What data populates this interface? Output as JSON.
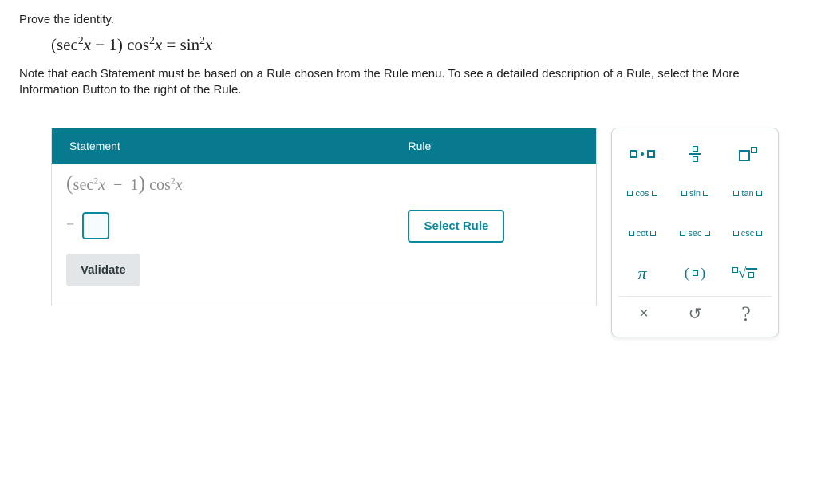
{
  "prompt": {
    "title": "Prove the identity.",
    "identity_html": "(sec²x − 1) cos²x = sin²x",
    "note": "Note that each Statement must be based on a Rule chosen from the Rule menu. To see a detailed description of a Rule, select the More Information Button to the right of the Rule."
  },
  "proof": {
    "header_statement": "Statement",
    "header_rule": "Rule",
    "starting_expr": "(sec²x − 1) cos²x",
    "equals": "=",
    "select_rule_label": "Select Rule",
    "validate_label": "Validate"
  },
  "palette": {
    "row1": {
      "mult": "·"
    },
    "row2": {
      "cos": "cos",
      "sin": "sin",
      "tan": "tan"
    },
    "row3": {
      "cot": "cot",
      "sec": "sec",
      "csc": "csc"
    },
    "row4": {
      "pi": "π",
      "paren_l": "(",
      "paren_r": ")"
    },
    "ctrl": {
      "close": "×",
      "undo": "↺",
      "help": "?"
    }
  }
}
